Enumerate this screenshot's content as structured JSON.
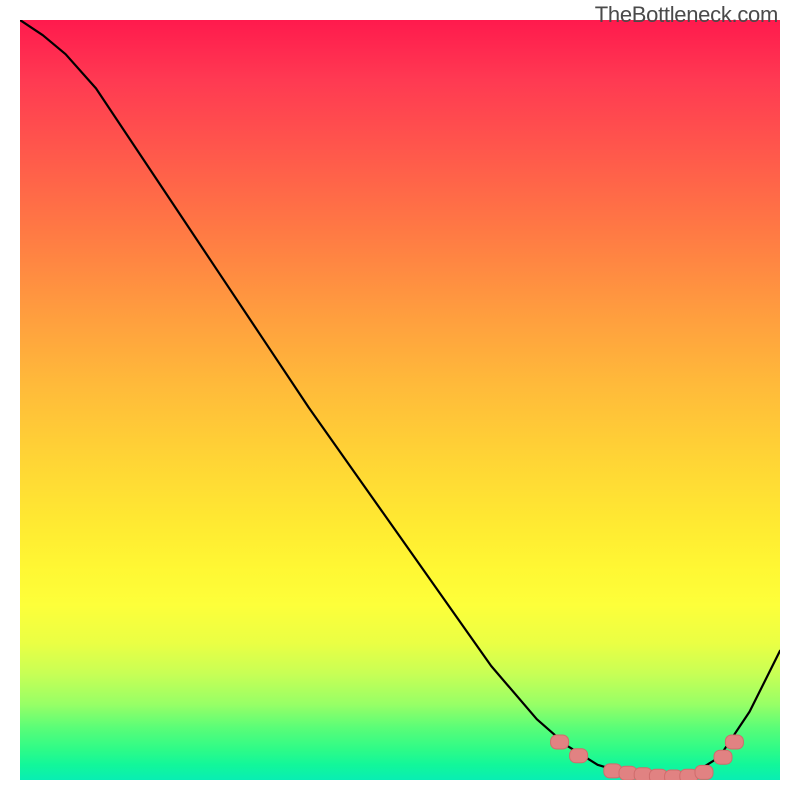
{
  "watermark": "TheBottleneck.com",
  "chart_data": {
    "type": "line",
    "title": "",
    "xlabel": "",
    "ylabel": "",
    "xlim": [
      0,
      100
    ],
    "ylim": [
      0,
      100
    ],
    "grid": false,
    "series": [
      {
        "name": "curve",
        "x": [
          0,
          3,
          6,
          10,
          14,
          20,
          26,
          32,
          38,
          44,
          50,
          56,
          62,
          68,
          72,
          76,
          80,
          84,
          88,
          92,
          96,
          100
        ],
        "values": [
          100,
          98,
          95.5,
          91,
          85,
          76,
          67,
          58,
          49,
          40.5,
          32,
          23.5,
          15,
          8,
          4.5,
          2,
          0.8,
          0.3,
          0.5,
          3,
          9,
          17
        ]
      }
    ],
    "markers": {
      "name": "highlight-markers",
      "shape": "rounded-rect",
      "color": "#e18282",
      "points": [
        {
          "x": 71,
          "y": 5.0
        },
        {
          "x": 73.5,
          "y": 3.2
        },
        {
          "x": 78,
          "y": 1.2
        },
        {
          "x": 80,
          "y": 0.9
        },
        {
          "x": 82,
          "y": 0.7
        },
        {
          "x": 84,
          "y": 0.5
        },
        {
          "x": 86,
          "y": 0.4
        },
        {
          "x": 88,
          "y": 0.5
        },
        {
          "x": 90,
          "y": 1.0
        },
        {
          "x": 92.5,
          "y": 3.0
        },
        {
          "x": 94,
          "y": 5.0
        }
      ]
    }
  }
}
